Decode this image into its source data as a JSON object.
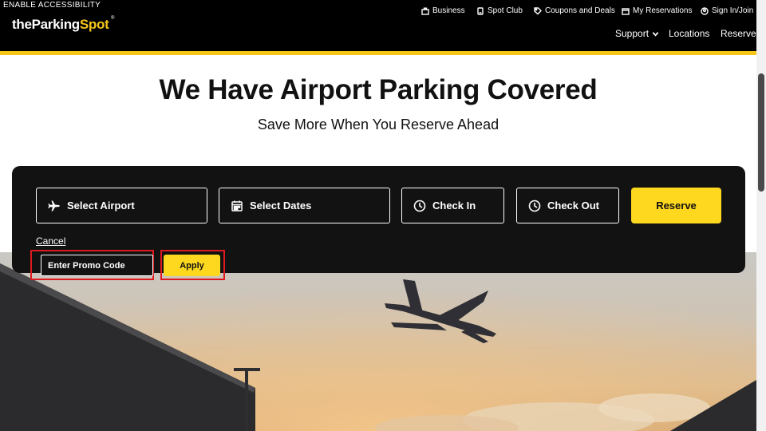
{
  "header": {
    "accessibility_label": "ENABLE ACCESSIBILITY",
    "logo_the": "the",
    "logo_parking": "Parking",
    "logo_spot": "Spot",
    "logo_reg": "®",
    "top_links": {
      "business": "Business",
      "spot_club": "Spot Club",
      "coupons": "Coupons and Deals",
      "reservations": "My Reservations",
      "sign_in": "Sign In/Join"
    },
    "nav": {
      "support": "Support",
      "locations": "Locations",
      "reserve": "Reserve"
    }
  },
  "hero": {
    "title": "We Have Airport Parking Covered",
    "subtitle": "Save More When You Reserve Ahead"
  },
  "booking": {
    "airport_label": "Select Airport",
    "dates_label": "Select Dates",
    "checkin_label": "Check In",
    "checkout_label": "Check Out",
    "reserve_label": "Reserve",
    "cancel_label": "Cancel",
    "promo_placeholder": "Enter Promo Code",
    "apply_label": "Apply"
  },
  "colors": {
    "brand_yellow": "#fed71f",
    "header_black": "#000000",
    "panel_dark": "#121212",
    "highlight_red": "#e0191f"
  },
  "icons": [
    "briefcase-icon",
    "card-icon",
    "tag-icon",
    "calendar-icon",
    "user-icon",
    "chevron-down-icon",
    "plane-icon",
    "clock-icon"
  ]
}
